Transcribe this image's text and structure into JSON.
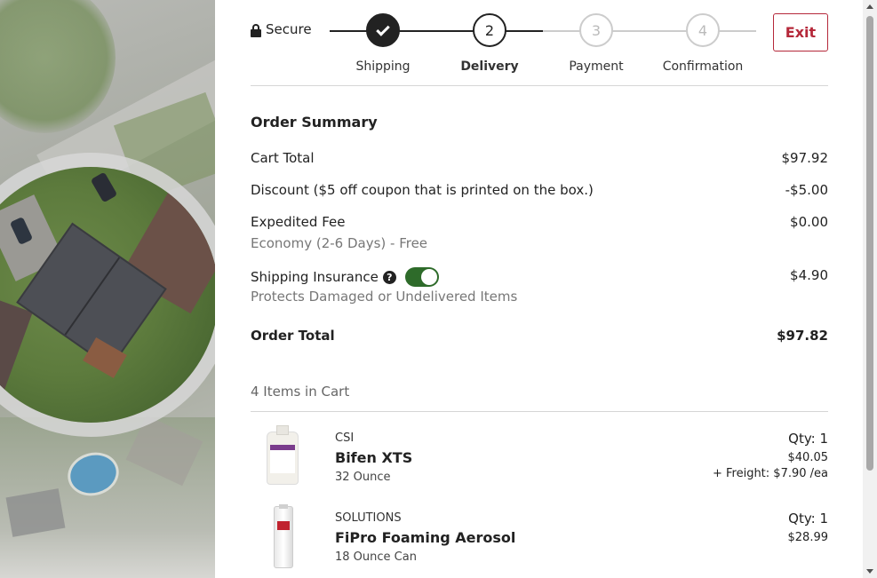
{
  "header": {
    "secure_label": "Secure",
    "exit_label": "Exit",
    "steps": [
      {
        "number": "1",
        "label": "Shipping",
        "state": "done"
      },
      {
        "number": "2",
        "label": "Delivery",
        "state": "current"
      },
      {
        "number": "3",
        "label": "Payment",
        "state": "future"
      },
      {
        "number": "4",
        "label": "Confirmation",
        "state": "future"
      }
    ]
  },
  "summary": {
    "title": "Order Summary",
    "cart_total_label": "Cart Total",
    "cart_total_value": "$97.92",
    "discount_label": "Discount ($5 off coupon that is printed on the box.)",
    "discount_value": "-$5.00",
    "expedited_label": "Expedited Fee",
    "expedited_sub": "Economy (2-6 Days) - Free",
    "expedited_value": "$0.00",
    "insurance_label": "Shipping Insurance",
    "insurance_help": "?",
    "insurance_sub": "Protects Damaged or Undelivered Items",
    "insurance_value": "$4.90",
    "insurance_enabled": true,
    "order_total_label": "Order Total",
    "order_total_value": "$97.82"
  },
  "cart": {
    "count_label": "4 Items in Cart",
    "items": [
      {
        "brand": "CSI",
        "name": "Bifen XTS",
        "size": "32 Ounce",
        "qty": "Qty: 1",
        "price": "$40.05",
        "freight": "+ Freight: $7.90 /ea"
      },
      {
        "brand": "SOLUTIONS",
        "name": "FiPro Foaming Aerosol",
        "size": "18 Ounce Can",
        "qty": "Qty: 1",
        "price": "$28.99"
      }
    ]
  },
  "colors": {
    "accent_red": "#b5283a",
    "toggle_green": "#2e6b2a",
    "dark": "#222222"
  }
}
